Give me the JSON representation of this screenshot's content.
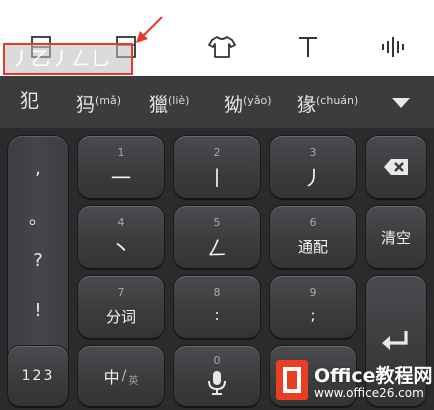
{
  "toolbar": {
    "input_preview": "丿乙丿ㄥ乚",
    "icons": [
      "keyboard-layout-icon",
      "crop-icon",
      "shirt-icon",
      "text-icon",
      "voice-wave-icon"
    ]
  },
  "candidates": [
    {
      "char": "犯",
      "pinyin": ""
    },
    {
      "char": "犸",
      "pinyin": "(mǎ)"
    },
    {
      "char": "獵",
      "pinyin": "(liè)"
    },
    {
      "char": "狕",
      "pinyin": "(yǎo)"
    },
    {
      "char": "猭",
      "pinyin": "(chuán)"
    }
  ],
  "symbols": [
    ",",
    "。",
    "?",
    "!"
  ],
  "keys": {
    "k1": {
      "num": "1",
      "label": "一"
    },
    "k2": {
      "num": "2",
      "label": "丨"
    },
    "k3": {
      "num": "3",
      "label": "丿"
    },
    "k4": {
      "num": "4",
      "label": "丶"
    },
    "k5": {
      "num": "5",
      "label": "ㄥ"
    },
    "k6": {
      "num": "6",
      "label": "通配"
    },
    "k7": {
      "num": "7",
      "label": "分词"
    },
    "k8": {
      "num": "8",
      "label": ":"
    },
    "k9": {
      "num": "9",
      "label": ";"
    },
    "k0": {
      "num": "0",
      "label": ""
    },
    "clear": "清空",
    "numbers": "123",
    "lang_main": "中",
    "lang_sep": "/",
    "lang_alt": "英"
  },
  "watermark": {
    "title": "Office教程网",
    "url": "www.office26.com"
  },
  "colors": {
    "keyboard_bg": "#2a2b2d",
    "candidate_bg": "#3b3c3e",
    "highlight_border": "#e8382d",
    "watermark_orange": "#ea3e23"
  }
}
